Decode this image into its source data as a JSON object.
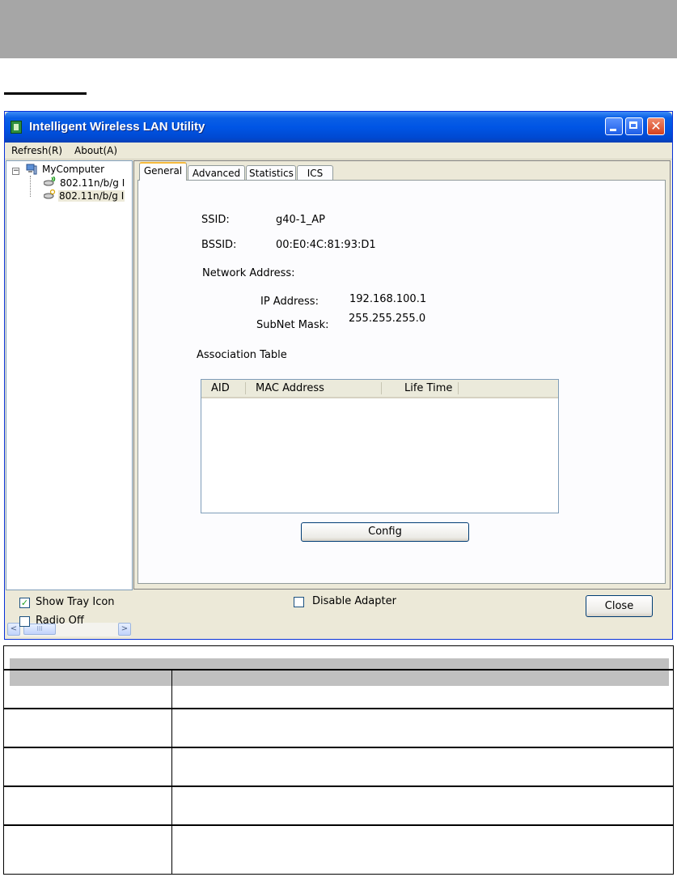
{
  "window": {
    "title": "Intelligent Wireless LAN Utility",
    "close_glyph": "✕"
  },
  "menu": {
    "refresh": "Refresh(R)",
    "about": "About(A)"
  },
  "tree": {
    "expander": "−",
    "root": "MyComputer",
    "adapters": [
      "802.11n/b/g I",
      "802.11n/b/g I"
    ],
    "scroll_left": "<",
    "scroll_right": ">",
    "thumb_grip": "III"
  },
  "tabs": [
    "General",
    "Advanced",
    "Statistics",
    "ICS"
  ],
  "general": {
    "ssid_label": "SSID:",
    "ssid_value": "g40-1_AP",
    "bssid_label": "BSSID:",
    "bssid_value": "00:E0:4C:81:93:D1",
    "network_address_label": "Network Address:",
    "ip_label": "IP Address:",
    "ip_value": "192.168.100.1",
    "mask_label": "SubNet Mask:",
    "mask_value": "255.255.255.0",
    "assoc_label": "Association Table",
    "assoc_columns": [
      "AID",
      "MAC Address",
      "Life Time"
    ],
    "config_button": "Config"
  },
  "bottom": {
    "show_tray_icon": "Show Tray Icon",
    "show_tray_checked": "✓",
    "radio_off": "Radio Off",
    "disable_adapter": "Disable Adapter",
    "close_button": "Close"
  },
  "colors": {
    "titlebar": "#0055e5",
    "window_bg": "#ece9d8",
    "banner": "#a6a6a6"
  }
}
